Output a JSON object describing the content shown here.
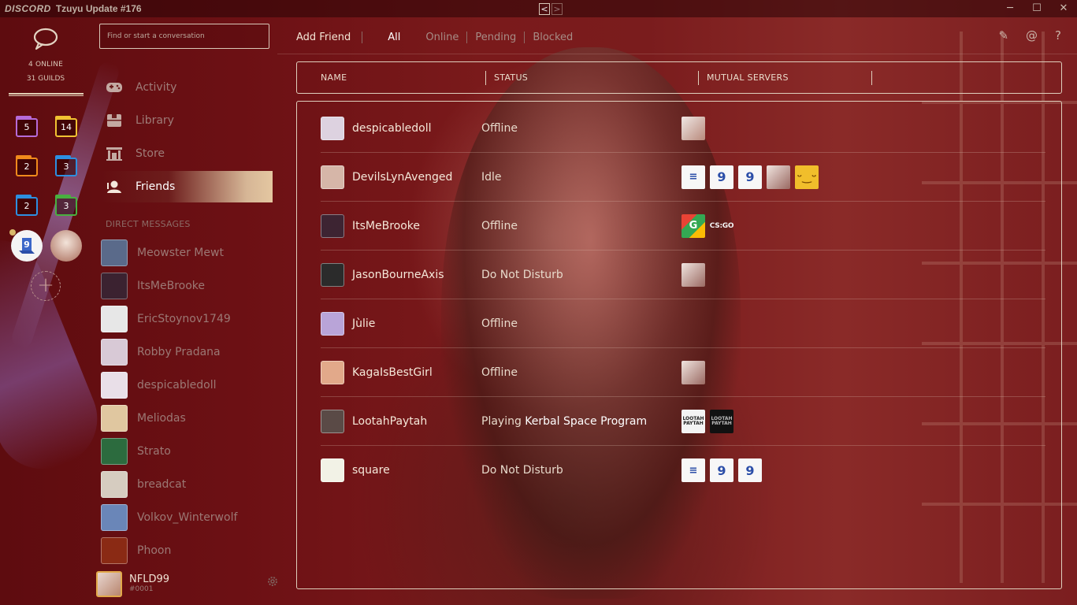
{
  "window": {
    "brand": "DISCORD",
    "title": "Tzuyu Update #176",
    "back": "<",
    "forward": ">",
    "minimize": "─",
    "maximize": "☐",
    "close": "✕"
  },
  "guilds": {
    "online": "4 ONLINE",
    "guild_count": "31 GUILDS",
    "folders": [
      {
        "count": "5",
        "color": "#b66bd8"
      },
      {
        "count": "14",
        "color": "#f1c232"
      },
      {
        "count": "2",
        "color": "#f08a1c"
      },
      {
        "count": "3",
        "color": "#2d8fe0"
      },
      {
        "count": "2",
        "color": "#2d8fe0"
      },
      {
        "count": "3",
        "color": "#49b040"
      }
    ],
    "add_label": "+"
  },
  "search": {
    "placeholder": "Find or start a conversation"
  },
  "nav": [
    {
      "label": "Activity",
      "icon": "gamepad-icon"
    },
    {
      "label": "Library",
      "icon": "library-icon"
    },
    {
      "label": "Store",
      "icon": "store-icon"
    },
    {
      "label": "Friends",
      "icon": "friends-icon"
    }
  ],
  "direct_messages": {
    "header": "DIRECT MESSAGES",
    "items": [
      {
        "name": "Meowster Mewt",
        "color": "#5a6a8a"
      },
      {
        "name": "ItsMeBrooke",
        "color": "#3b2230"
      },
      {
        "name": "EricStoynov1749",
        "color": "#e7e7e7"
      },
      {
        "name": "Robby Pradana",
        "color": "#d8c9d6"
      },
      {
        "name": "despicabledoll",
        "color": "#e9dfe8"
      },
      {
        "name": "Meliodas",
        "color": "#e0c7a0"
      },
      {
        "name": "Strato",
        "color": "#2c6b3e"
      },
      {
        "name": "breadcat",
        "color": "#d6ccc0"
      },
      {
        "name": "Volkov_Winterwolf",
        "color": "#6a86b8"
      },
      {
        "name": "Phoon",
        "color": "#8a2a14"
      }
    ]
  },
  "user": {
    "name": "NFLD99",
    "discriminator": "#0001"
  },
  "tabs": {
    "add_friend": "Add Friend",
    "all": "All",
    "online": "Online",
    "pending": "Pending",
    "blocked": "Blocked"
  },
  "top_icons": {
    "new_dm": "✎",
    "mentions": "@",
    "help": "?"
  },
  "table": {
    "headers": {
      "name": "NAME",
      "status": "STATUS",
      "mutual": "MUTUAL SERVERS"
    },
    "rows": [
      {
        "name": "despicabledoll",
        "status": "Offline",
        "avatar": "#ddd2e0",
        "servers": [
          "photo"
        ]
      },
      {
        "name": "DevilsLynAvenged",
        "status": "Idle",
        "avatar": "#d6b6a8",
        "servers": [
          "d",
          "g",
          "g",
          "anime",
          "smile"
        ]
      },
      {
        "name": "ItsMeBrooke",
        "status": "Offline",
        "avatar": "#3d2432",
        "servers": [
          "google",
          "csgo"
        ]
      },
      {
        "name": "JasonBourneAxis",
        "status": "Do Not Disturb",
        "avatar": "#2b2b2b",
        "servers": [
          "anime"
        ]
      },
      {
        "name": "Jùlie",
        "status": "Offline",
        "avatar": "#b9a4d8",
        "servers": []
      },
      {
        "name": "KagaIsBestGirl",
        "status": "Offline",
        "avatar": "#e2a98a",
        "servers": [
          "anime"
        ]
      },
      {
        "name": "LootahPaytah",
        "status_prefix": "Playing ",
        "status_game": "Kerbal Space Program",
        "avatar": "#5a4a46",
        "servers": [
          "lp1",
          "lp2"
        ]
      },
      {
        "name": "square",
        "status": "Do Not Disturb",
        "avatar": "#f2f2e6",
        "servers": [
          "d",
          "g",
          "g"
        ]
      }
    ]
  },
  "server_glyphs": {
    "d": "≡",
    "g": "9",
    "smile": "ᵕ‿ᵕ",
    "google": "G",
    "csgo": "CS:GO",
    "lp": "LOOTAH PAYTAH"
  }
}
